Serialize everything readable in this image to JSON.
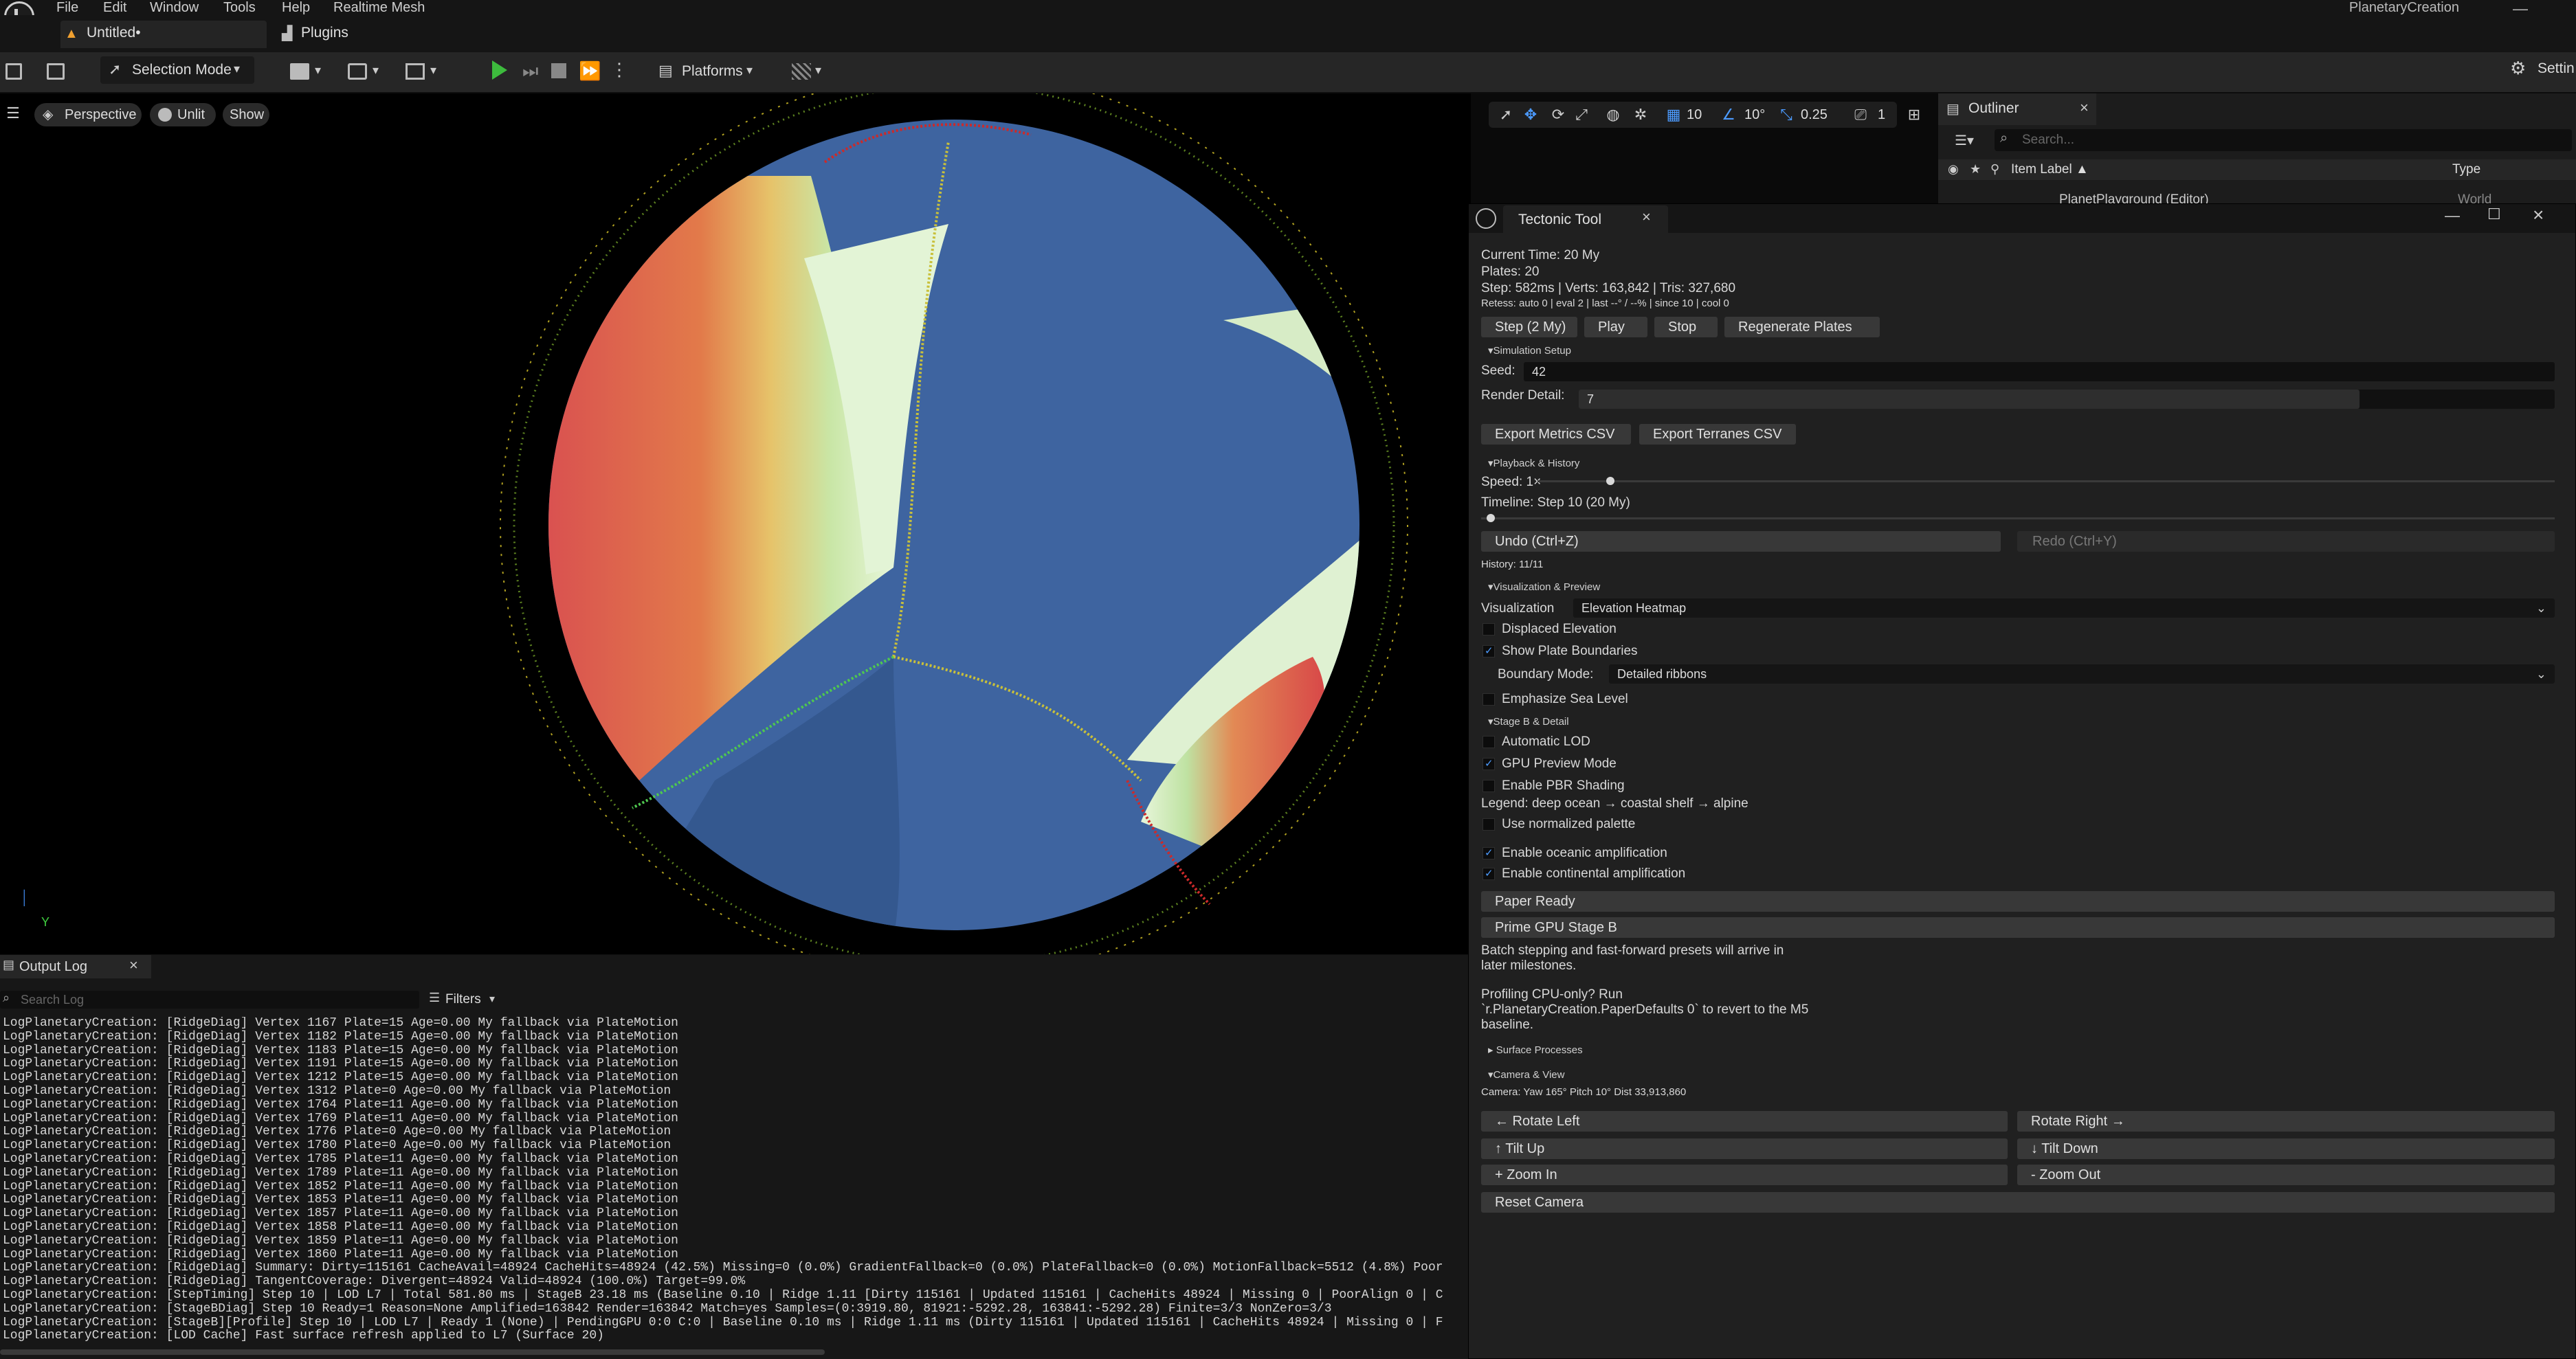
{
  "menubar": {
    "items": [
      "File",
      "Edit",
      "Window",
      "Tools",
      "Help",
      "Realtime Mesh"
    ],
    "app_title": "PlanetaryCreation"
  },
  "tabs": {
    "level": "Untitled•",
    "plugins": "Plugins"
  },
  "toolbar": {
    "selection_mode": "Selection Mode",
    "platforms": "Platforms",
    "settings": "Settin"
  },
  "viewport": {
    "perspective": "Perspective",
    "unlit": "Unlit",
    "show": "Show",
    "grid_snap": "10",
    "rot_snap": "10°",
    "scale_snap": "0.25",
    "camera_speed": "1",
    "axis_y": "Y"
  },
  "outliner": {
    "title": "Outliner",
    "search_placeholder": "Search...",
    "col_label": "Item Label ▲",
    "col_type": "Type",
    "row": "PlanetPlayground (Editor)",
    "row_type": "World"
  },
  "tectonic": {
    "title": "Tectonic Tool",
    "current_time": "Current Time: 20 My",
    "plates": "Plates: 20",
    "step_stats": "Step: 582ms | Verts: 163,842 | Tris: 327,680",
    "retess": "Retess: auto 0 | eval 2 | last --° / --% | since 10 | cool 0",
    "btn_step": "Step (2 My)",
    "btn_play": "Play",
    "btn_stop": "Stop",
    "btn_regen": "Regenerate Plates",
    "sec_sim": "Simulation Setup",
    "seed_label": "Seed:",
    "seed_value": "42",
    "render_detail_label": "Render Detail:",
    "render_detail_value": "7",
    "render_detail_level": 0.8,
    "btn_export_metrics": "Export Metrics CSV",
    "btn_export_terranes": "Export Terranes CSV",
    "sec_playback": "Playback & History",
    "speed_label": "Speed: 1×",
    "timeline_label": "Timeline: Step 10 (20 My)",
    "btn_undo": "Undo (Ctrl+Z)",
    "btn_redo": "Redo (Ctrl+Y)",
    "history": "History: 11/11",
    "sec_vis": "Visualization & Preview",
    "vis_label": "Visualization",
    "vis_value": "Elevation Heatmap",
    "displaced": "Displaced Elevation",
    "show_boundaries": "Show Plate Boundaries",
    "boundary_mode_label": "Boundary Mode:",
    "boundary_mode_value": "Detailed ribbons",
    "emphasize_sea": "Emphasize Sea Level",
    "sec_stageb": "Stage B & Detail",
    "auto_lod": "Automatic LOD",
    "gpu_preview": "GPU Preview Mode",
    "pbr": "Enable PBR Shading",
    "legend": "Legend: deep ocean → coastal shelf → alpine",
    "normalized": "Use normalized palette",
    "oceanic_amp": "Enable oceanic amplification",
    "continental_amp": "Enable continental amplification",
    "btn_paper_ready": "Paper Ready",
    "btn_prime_gpu": "Prime GPU Stage B",
    "note1a": "Batch stepping and fast-forward presets will arrive in",
    "note1b": "later milestones.",
    "note2a": "Profiling CPU-only? Run",
    "note2b": "`r.PlanetaryCreation.PaperDefaults 0` to revert to the M5",
    "note2c": "baseline.",
    "sec_surface": "Surface Processes",
    "sec_camera": "Camera & View",
    "camera_info": "Camera: Yaw 165° Pitch 10° Dist 33,913,860",
    "btn_rot_left": "← Rotate Left",
    "btn_rot_right": "Rotate Right →",
    "btn_tilt_up": "↑ Tilt Up",
    "btn_tilt_down": "↓ Tilt Down",
    "btn_zoom_in": "+ Zoom In",
    "btn_zoom_out": "- Zoom Out",
    "btn_reset_cam": "Reset Camera"
  },
  "outputlog": {
    "title": "Output Log",
    "search_placeholder": "Search Log",
    "filters": "Filters",
    "lines": [
      "LogPlanetaryCreation: [RidgeDiag] Vertex 1167 Plate=15 Age=0.00 My fallback via PlateMotion",
      "LogPlanetaryCreation: [RidgeDiag] Vertex 1182 Plate=15 Age=0.00 My fallback via PlateMotion",
      "LogPlanetaryCreation: [RidgeDiag] Vertex 1183 Plate=15 Age=0.00 My fallback via PlateMotion",
      "LogPlanetaryCreation: [RidgeDiag] Vertex 1191 Plate=15 Age=0.00 My fallback via PlateMotion",
      "LogPlanetaryCreation: [RidgeDiag] Vertex 1212 Plate=15 Age=0.00 My fallback via PlateMotion",
      "LogPlanetaryCreation: [RidgeDiag] Vertex 1312 Plate=0 Age=0.00 My fallback via PlateMotion",
      "LogPlanetaryCreation: [RidgeDiag] Vertex 1764 Plate=11 Age=0.00 My fallback via PlateMotion",
      "LogPlanetaryCreation: [RidgeDiag] Vertex 1769 Plate=11 Age=0.00 My fallback via PlateMotion",
      "LogPlanetaryCreation: [RidgeDiag] Vertex 1776 Plate=0 Age=0.00 My fallback via PlateMotion",
      "LogPlanetaryCreation: [RidgeDiag] Vertex 1780 Plate=0 Age=0.00 My fallback via PlateMotion",
      "LogPlanetaryCreation: [RidgeDiag] Vertex 1785 Plate=11 Age=0.00 My fallback via PlateMotion",
      "LogPlanetaryCreation: [RidgeDiag] Vertex 1789 Plate=11 Age=0.00 My fallback via PlateMotion",
      "LogPlanetaryCreation: [RidgeDiag] Vertex 1852 Plate=11 Age=0.00 My fallback via PlateMotion",
      "LogPlanetaryCreation: [RidgeDiag] Vertex 1853 Plate=11 Age=0.00 My fallback via PlateMotion",
      "LogPlanetaryCreation: [RidgeDiag] Vertex 1857 Plate=11 Age=0.00 My fallback via PlateMotion",
      "LogPlanetaryCreation: [RidgeDiag] Vertex 1858 Plate=11 Age=0.00 My fallback via PlateMotion",
      "LogPlanetaryCreation: [RidgeDiag] Vertex 1859 Plate=11 Age=0.00 My fallback via PlateMotion",
      "LogPlanetaryCreation: [RidgeDiag] Vertex 1860 Plate=11 Age=0.00 My fallback via PlateMotion",
      "LogPlanetaryCreation: [RidgeDiag] Summary: Dirty=115161 CacheAvail=48924 CacheHits=48924 (42.5%) Missing=0 (0.0%) GradientFallback=0 (0.0%) PlateFallback=0 (0.0%) MotionFallback=5512 (4.8%) Poor",
      "LogPlanetaryCreation: [RidgeDiag] TangentCoverage: Divergent=48924 Valid=48924 (100.0%) Target=99.0%",
      "LogPlanetaryCreation: [StepTiming] Step 10 | LOD L7 | Total 581.80 ms | StageB 23.18 ms (Baseline 0.10 | Ridge 1.11 [Dirty 115161 | Updated 115161 | CacheHits 48924 | Missing 0 | PoorAlign 0 | C",
      "LogPlanetaryCreation: [StageBDiag] Step 10 Ready=1 Reason=None Amplified=163842 Render=163842 Match=yes Samples=(0:3919.80, 81921:-5292.28, 163841:-5292.28) Finite=3/3 NonZero=3/3",
      "LogPlanetaryCreation: [StageB][Profile] Step 10 | LOD L7 | Ready 1 (None) | PendingGPU 0:0 C:0 | Baseline 0.10 ms | Ridge 1.11 ms (Dirty 115161 | Updated 115161 | CacheHits 48924 | Missing 0 | F",
      "LogPlanetaryCreation: [LOD Cache] Fast surface refresh applied to L7 (Surface 20)"
    ]
  }
}
